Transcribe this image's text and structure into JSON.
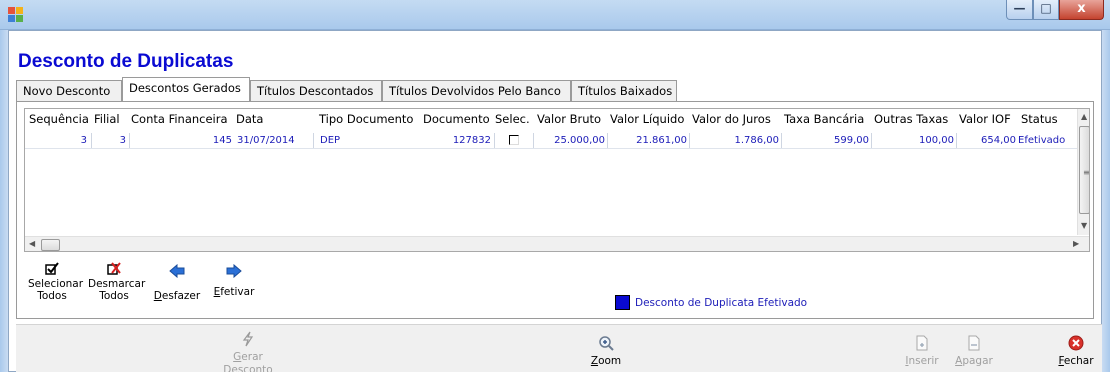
{
  "window": {
    "min_glyph": "—",
    "max_glyph": "□",
    "close_glyph": "x"
  },
  "title": "Desconto de Duplicatas",
  "tabs": [
    {
      "label": "Novo Desconto",
      "active": false
    },
    {
      "label": "Descontos Gerados",
      "active": true
    },
    {
      "label": "Títulos Descontados",
      "active": false
    },
    {
      "label": "Títulos Devolvidos Pelo Banco",
      "active": false
    },
    {
      "label": "Títulos Baixados",
      "active": false
    }
  ],
  "grid": {
    "columns": [
      "Sequência",
      "Filial",
      "Conta Financeira",
      "Data",
      "Tipo Documento",
      "Documento",
      "Selec.",
      "Valor Bruto",
      "Valor Líquido",
      "Valor do Juros",
      "Taxa Bancária",
      "Outras Taxas",
      "Valor IOF",
      "Status"
    ],
    "rows": [
      {
        "sequencia": "3",
        "filial": "3",
        "conta_financeira": "145",
        "data": "31/07/2014",
        "tipo_documento": "DEP",
        "documento": "127832",
        "selec": false,
        "valor_bruto": "25.000,00",
        "valor_liquido": "21.861,00",
        "valor_juros": "1.786,00",
        "taxa_bancaria": "599,00",
        "outras_taxas": "100,00",
        "valor_iof": "654,00",
        "status": "Efetivado"
      }
    ]
  },
  "toolbar": {
    "selecionar_todos": {
      "line1": "Selecionar",
      "line2": "Todos",
      "icon": "checkbox-checked-icon"
    },
    "desmarcar_todos": {
      "line1": "Desmarcar",
      "line2": "Todos",
      "icon": "checkbox-uncheck-icon"
    },
    "desfazer": {
      "label_u": "D",
      "label_rest": "esfazer",
      "icon": "arrow-left-icon"
    },
    "efetivar": {
      "label_u": "E",
      "label_rest": "fetivar",
      "icon": "arrow-right-icon"
    }
  },
  "legend": {
    "text": "Desconto de Duplicata Efetivado",
    "color": "#0a0ad2"
  },
  "bottom": {
    "gerar": {
      "line1_u": "G",
      "line1_rest": "erar",
      "line2": "Desconto",
      "enabled": false,
      "icon": "lightning-icon"
    },
    "zoom": {
      "label_u": "Z",
      "label_rest": "oom",
      "enabled": true,
      "icon": "zoom-icon"
    },
    "inserir": {
      "label_u": "I",
      "label_rest": "nserir",
      "enabled": false,
      "icon": "insert-doc-icon"
    },
    "apagar": {
      "label_u": "A",
      "label_rest": "pagar",
      "enabled": false,
      "icon": "delete-doc-icon"
    },
    "fechar": {
      "label_u": "F",
      "label_rest": "echar",
      "enabled": true,
      "icon": "close-circle-icon"
    }
  },
  "colors": {
    "title": "#0a0ad2",
    "cell_text": "#1c1cb8",
    "close_btn": "#c4432f"
  }
}
